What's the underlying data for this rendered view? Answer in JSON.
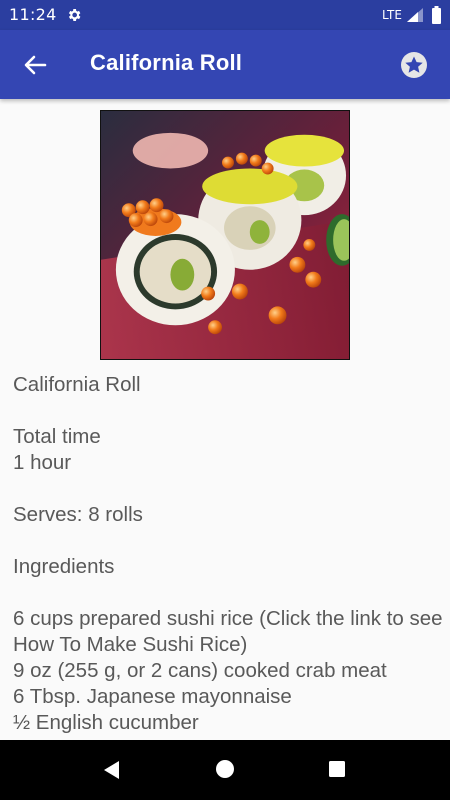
{
  "status_bar": {
    "time": "11:24",
    "network": "LTE",
    "icons": [
      "gear-icon",
      "signal-icon",
      "battery-icon"
    ]
  },
  "app_bar": {
    "title": "California Roll",
    "back_icon": "arrow-back-icon",
    "favorite_icon": "star-icon"
  },
  "recipe": {
    "image_alt": "California roll sushi with orange roe",
    "name": "California Roll",
    "total_time_label": "Total time",
    "total_time_value": "1 hour",
    "serves": "Serves: 8 rolls",
    "ingredients_heading": "Ingredients",
    "ingredients": [
      "6 cups prepared sushi rice (Click the link to see How To Make Sushi Rice)",
      "9 oz (255 g, or 2 cans) cooked crab meat",
      "6 Tbsp. Japanese mayonnaise",
      "½ English cucumber"
    ]
  },
  "nav_bar": {
    "icons": [
      "nav-back-icon",
      "nav-home-icon",
      "nav-recents-icon"
    ]
  },
  "colors": {
    "status_bar": "#2b3ea0",
    "app_bar": "#3446b3",
    "body_text": "#595959",
    "background": "#fafafa"
  }
}
